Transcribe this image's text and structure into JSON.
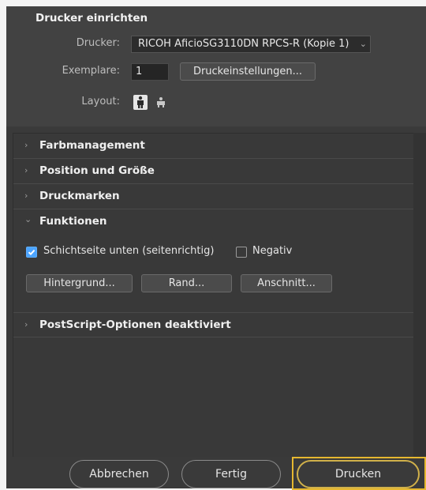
{
  "setup": {
    "title": "Drucker einrichten",
    "printer_label": "Drucker:",
    "printer_value": "RICOH AficioSG3110DN RPCS-R (Kopie 1)",
    "copies_label": "Exemplare:",
    "copies_value": "1",
    "print_settings_button": "Druckeinstellungen...",
    "layout_label": "Layout:",
    "layout_options": [
      "portrait-layout-icon",
      "landscape-layout-icon"
    ],
    "layout_selected": "portrait"
  },
  "sections": [
    {
      "label": "Farbmanagement",
      "expanded": false
    },
    {
      "label": "Position und Größe",
      "expanded": false
    },
    {
      "label": "Druckmarken",
      "expanded": false
    },
    {
      "label": "Funktionen",
      "expanded": true
    },
    {
      "label": "PostScript-Optionen deaktiviert",
      "expanded": false
    }
  ],
  "funktionen": {
    "emulsion_down_label": "Schichtseite unten (seitenrichtig)",
    "emulsion_down_checked": true,
    "negative_label": "Negativ",
    "negative_checked": false,
    "background_button": "Hintergrund...",
    "border_button": "Rand...",
    "bleed_button": "Anschnitt..."
  },
  "footer": {
    "cancel": "Abbrechen",
    "done": "Fertig",
    "print": "Drucken"
  },
  "colors": {
    "dialog_bg": "#3a3a3a",
    "accent_checkbox": "#4ba4ff",
    "focus_ring": "#e6b830"
  }
}
